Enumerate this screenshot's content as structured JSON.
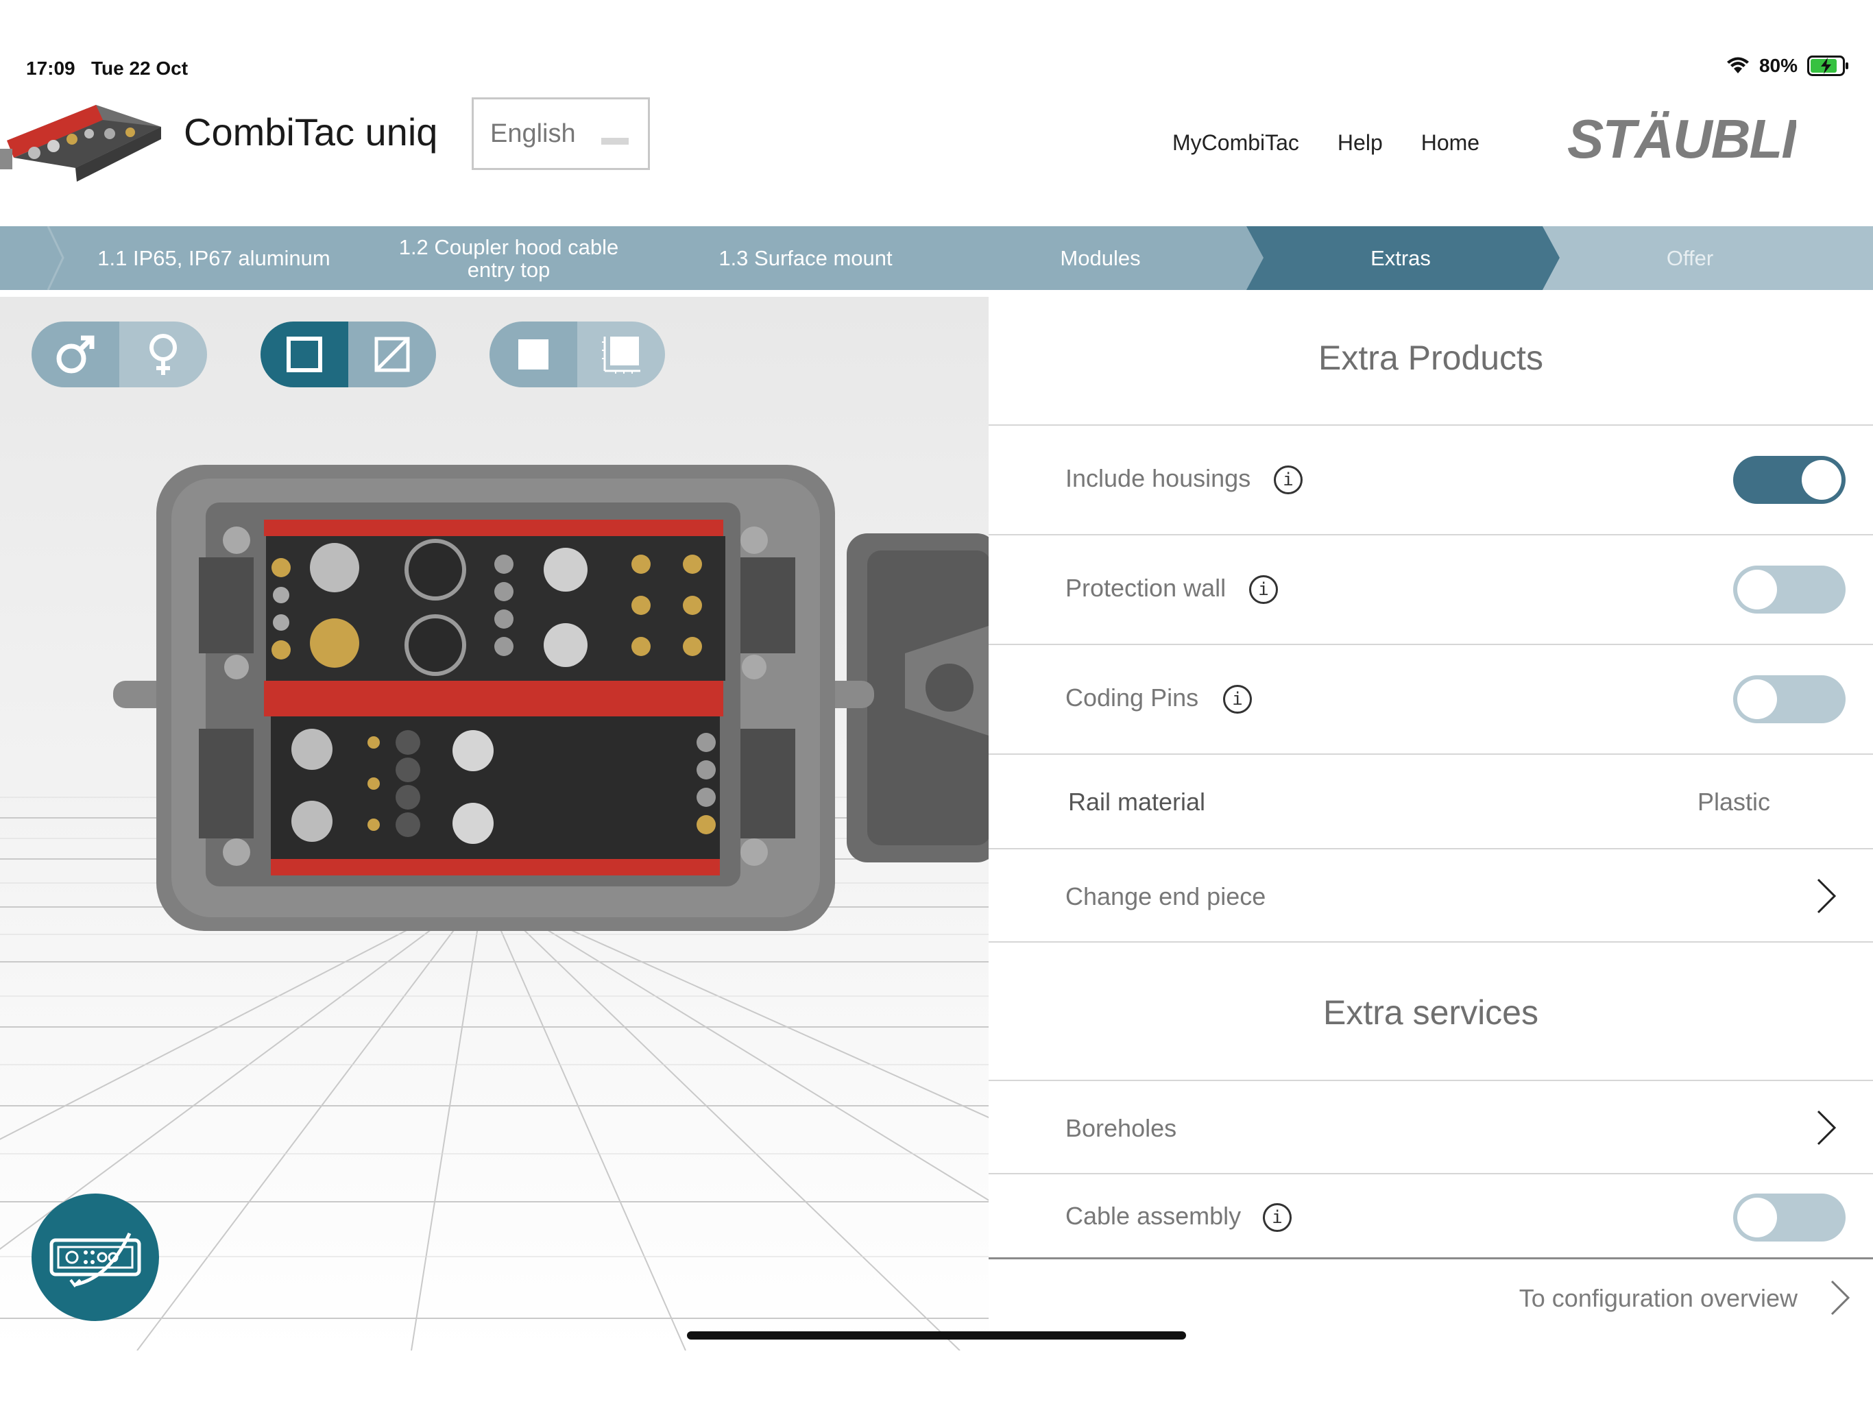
{
  "status_bar": {
    "time": "17:09",
    "date": "Tue 22 Oct",
    "battery": "80%",
    "icons": [
      "wifi-icon",
      "battery-charging-icon"
    ]
  },
  "header": {
    "app_title": "CombiTac uniq",
    "language": "English",
    "nav": [
      "MyCombiTac",
      "Help",
      "Home"
    ],
    "logo_text": "STÄUBLI"
  },
  "steps": [
    {
      "label": "1.1 IP65, IP67 aluminum",
      "state": "done"
    },
    {
      "label": "1.2 Coupler hood cable entry top",
      "state": "done"
    },
    {
      "label": "1.3 Surface mount",
      "state": "done"
    },
    {
      "label": "Modules",
      "state": "done"
    },
    {
      "label": "Extras",
      "state": "active"
    },
    {
      "label": "Offer",
      "state": "todo"
    }
  ],
  "viewer": {
    "toggle_groups": [
      {
        "name": "gender",
        "icons": [
          "male-icon",
          "female-icon"
        ],
        "selected": 0
      },
      {
        "name": "view",
        "icons": [
          "square-icon",
          "square-slash-icon"
        ],
        "selected": 0
      },
      {
        "name": "display",
        "icons": [
          "filled-square-icon",
          "ruler-square-icon"
        ],
        "selected": 0
      }
    ],
    "fab_icon": "connector-rotate-icon"
  },
  "panel": {
    "extra_products_title": "Extra Products",
    "include_housings": {
      "label": "Include housings",
      "on": true
    },
    "protection_wall": {
      "label": "Protection wall",
      "on": false
    },
    "coding_pins": {
      "label": "Coding Pins",
      "on": false
    },
    "rail_material": {
      "label": "Rail material",
      "value": "Plastic"
    },
    "change_end_piece": {
      "label": "Change end piece"
    },
    "extra_services_title": "Extra services",
    "boreholes": {
      "label": "Boreholes"
    },
    "cable_assembly": {
      "label": "Cable assembly",
      "on": false
    },
    "footer_link": "To configuration overview",
    "info_glyph": "i"
  },
  "colors": {
    "step_bar": "#8fadbb",
    "step_active": "#45758b",
    "toggle_active": "#1f6a80",
    "toggle_inactive": "#8fadbb",
    "switch_on": "#3f6f86",
    "switch_off": "#b7cad3"
  }
}
